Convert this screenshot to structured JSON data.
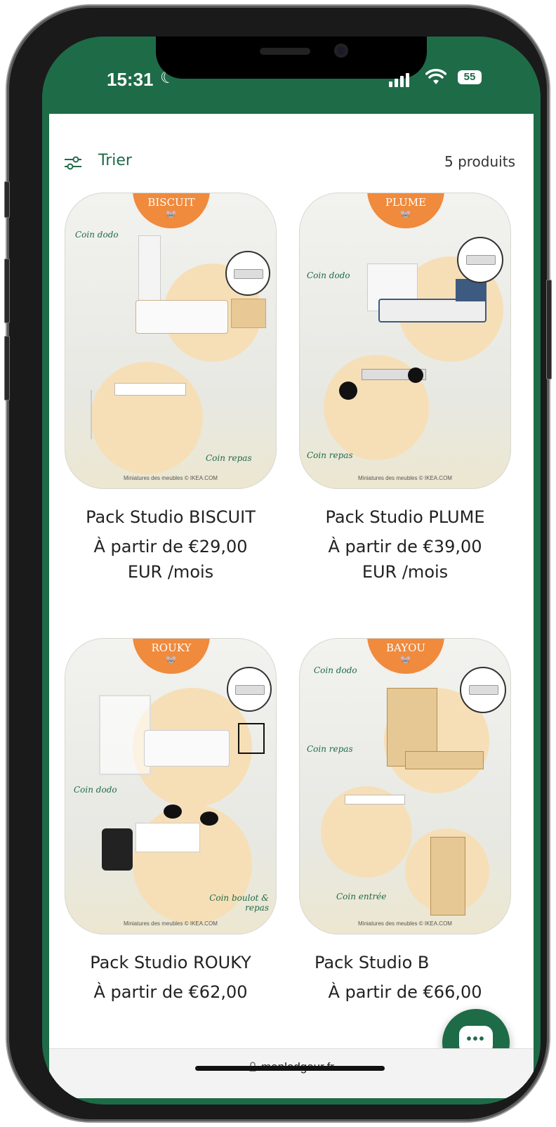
{
  "status_bar": {
    "time": "15:31",
    "battery": "55"
  },
  "toolbar": {
    "sort_label": "Trier",
    "product_count": "5 produits"
  },
  "products": [
    {
      "badge": "BISCUIT",
      "title": "Pack Studio BISCUIT",
      "price_line1": "À partir de €29,00",
      "price_line2": "EUR /mois",
      "labels": [
        "Coin dodo",
        "Coin repas"
      ]
    },
    {
      "badge": "PLUME",
      "title": "Pack Studio PLUME",
      "price_line1": "À partir de €39,00",
      "price_line2": "EUR /mois",
      "labels": [
        "Coin dodo",
        "Coin repas"
      ]
    },
    {
      "badge": "ROUKY",
      "title": "Pack Studio ROUKY",
      "price_line1": "À partir de €62,00",
      "price_line2": "",
      "labels": [
        "Coin dodo",
        "Coin boulot & repas"
      ]
    },
    {
      "badge": "BAYOU",
      "title": "Pack Studio B",
      "price_line1": "À partir de €66,00",
      "price_line2": "",
      "labels": [
        "Coin dodo",
        "Coin repas",
        "Coin entrée"
      ]
    }
  ],
  "image_credit": "Miniatures des meubles © IKEA.COM",
  "browser": {
    "url": "monlodgeur.fr"
  },
  "colors": {
    "brand_green": "#1e6b48",
    "badge_orange": "#f08a3c",
    "circle_peach": "#f6dfb7"
  },
  "icons": [
    "sort-sliders-icon",
    "lock-icon",
    "chat-icon",
    "wifi-icon",
    "moon-icon"
  ]
}
